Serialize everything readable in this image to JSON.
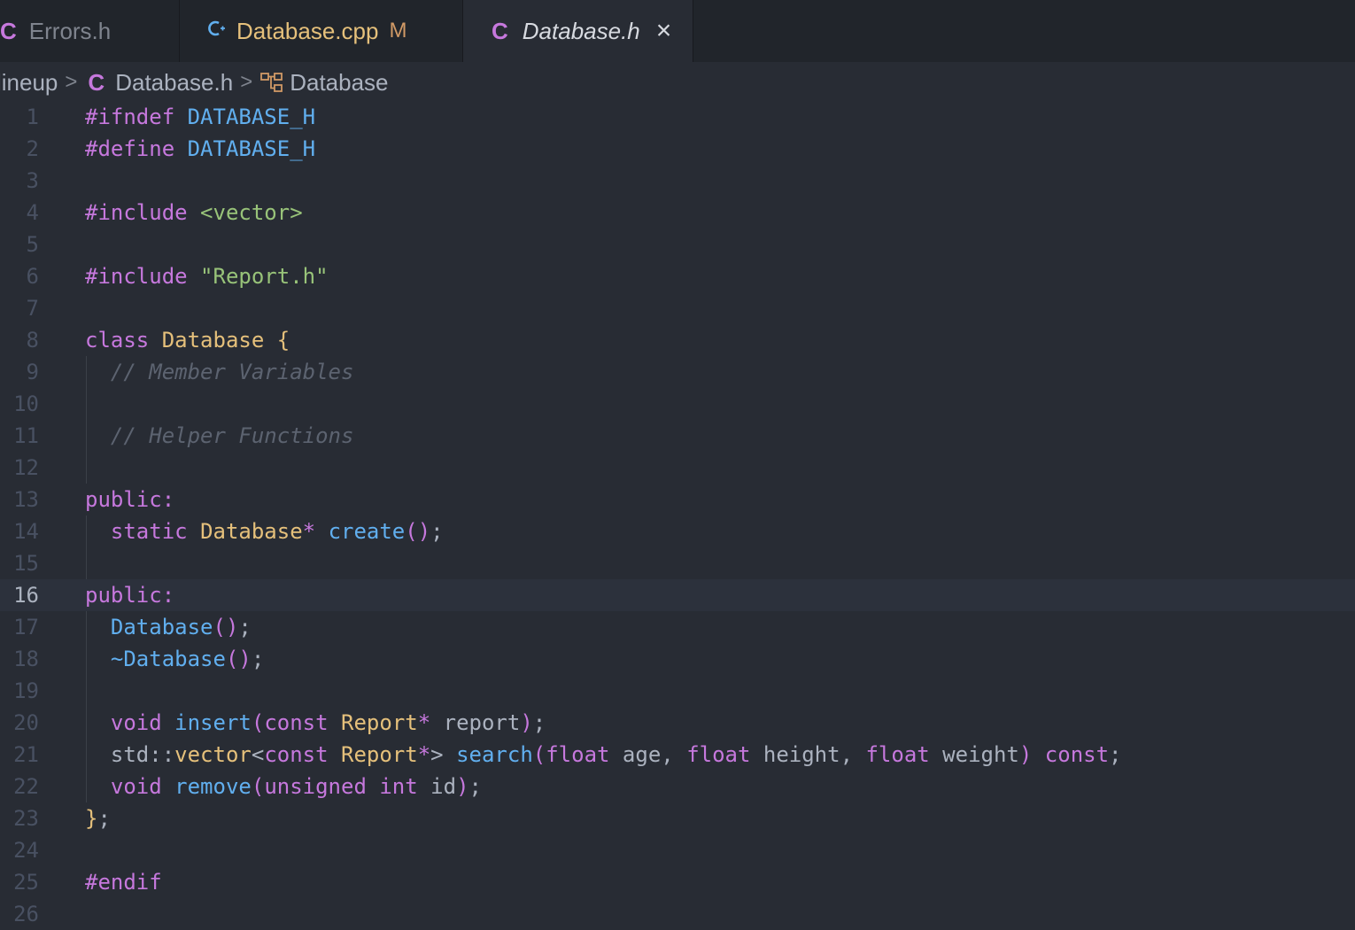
{
  "tabs": [
    {
      "icon": "C",
      "label": "Errors.h",
      "modified": "",
      "active": false
    },
    {
      "icon": "C+",
      "label": "Database.cpp",
      "modified": "M",
      "active": false
    },
    {
      "icon": "C",
      "label": "Database.h",
      "modified": "",
      "active": true,
      "close": "×"
    }
  ],
  "breadcrumb": {
    "folder": "lineup",
    "file_icon": "C",
    "file": "Database.h",
    "symbol": "Database"
  },
  "editor": {
    "current_line": 16,
    "lines": [
      {
        "n": "1",
        "tokens": [
          [
            "pp",
            "#ifndef"
          ],
          [
            "plain",
            " "
          ],
          [
            "mac",
            "DATABASE_H"
          ]
        ]
      },
      {
        "n": "2",
        "tokens": [
          [
            "pp",
            "#define"
          ],
          [
            "plain",
            " "
          ],
          [
            "mac",
            "DATABASE_H"
          ]
        ]
      },
      {
        "n": "3",
        "tokens": []
      },
      {
        "n": "4",
        "tokens": [
          [
            "pp",
            "#include"
          ],
          [
            "plain",
            " "
          ],
          [
            "str",
            "<vector>"
          ]
        ]
      },
      {
        "n": "5",
        "tokens": []
      },
      {
        "n": "6",
        "tokens": [
          [
            "pp",
            "#include"
          ],
          [
            "plain",
            " "
          ],
          [
            "str",
            "\"Report.h\""
          ]
        ]
      },
      {
        "n": "7",
        "tokens": []
      },
      {
        "n": "8",
        "tokens": [
          [
            "kw",
            "class"
          ],
          [
            "plain",
            " "
          ],
          [
            "cls",
            "Database"
          ],
          [
            "plain",
            " "
          ],
          [
            "br",
            "{"
          ]
        ]
      },
      {
        "n": "9",
        "tokens": [
          [
            "plain",
            "  "
          ],
          [
            "cm",
            "// Member Variables"
          ]
        ]
      },
      {
        "n": "10",
        "tokens": []
      },
      {
        "n": "11",
        "tokens": [
          [
            "plain",
            "  "
          ],
          [
            "cm",
            "// Helper Functions"
          ]
        ]
      },
      {
        "n": "12",
        "tokens": []
      },
      {
        "n": "13",
        "tokens": [
          [
            "kw",
            "public:"
          ]
        ]
      },
      {
        "n": "14",
        "tokens": [
          [
            "plain",
            "  "
          ],
          [
            "kw",
            "static"
          ],
          [
            "plain",
            " "
          ],
          [
            "cls",
            "Database"
          ],
          [
            "kw",
            "*"
          ],
          [
            "plain",
            " "
          ],
          [
            "fn",
            "create"
          ],
          [
            "pa",
            "()"
          ],
          [
            "op",
            ";"
          ]
        ]
      },
      {
        "n": "15",
        "tokens": []
      },
      {
        "n": "16",
        "tokens": [
          [
            "kw",
            "public:"
          ]
        ]
      },
      {
        "n": "17",
        "tokens": [
          [
            "plain",
            "  "
          ],
          [
            "fn",
            "Database"
          ],
          [
            "pa",
            "()"
          ],
          [
            "op",
            ";"
          ]
        ]
      },
      {
        "n": "18",
        "tokens": [
          [
            "plain",
            "  "
          ],
          [
            "fn",
            "~Database"
          ],
          [
            "pa",
            "()"
          ],
          [
            "op",
            ";"
          ]
        ]
      },
      {
        "n": "19",
        "tokens": []
      },
      {
        "n": "20",
        "tokens": [
          [
            "plain",
            "  "
          ],
          [
            "kw",
            "void"
          ],
          [
            "plain",
            " "
          ],
          [
            "fn",
            "insert"
          ],
          [
            "pa",
            "("
          ],
          [
            "kw",
            "const"
          ],
          [
            "plain",
            " "
          ],
          [
            "cls",
            "Report"
          ],
          [
            "kw",
            "*"
          ],
          [
            "plain",
            " report"
          ],
          [
            "pa",
            ")"
          ],
          [
            "op",
            ";"
          ]
        ]
      },
      {
        "n": "21",
        "tokens": [
          [
            "plain",
            "  std::"
          ],
          [
            "cls",
            "vector"
          ],
          [
            "op",
            "<"
          ],
          [
            "kw",
            "const"
          ],
          [
            "plain",
            " "
          ],
          [
            "cls",
            "Report"
          ],
          [
            "kw",
            "*"
          ],
          [
            "op",
            ">"
          ],
          [
            "plain",
            " "
          ],
          [
            "fn",
            "search"
          ],
          [
            "pa",
            "("
          ],
          [
            "kw",
            "float"
          ],
          [
            "plain",
            " age, "
          ],
          [
            "kw",
            "float"
          ],
          [
            "plain",
            " height, "
          ],
          [
            "kw",
            "float"
          ],
          [
            "plain",
            " weight"
          ],
          [
            "pa",
            ")"
          ],
          [
            "plain",
            " "
          ],
          [
            "kw",
            "const"
          ],
          [
            "op",
            ";"
          ]
        ]
      },
      {
        "n": "22",
        "tokens": [
          [
            "plain",
            "  "
          ],
          [
            "kw",
            "void"
          ],
          [
            "plain",
            " "
          ],
          [
            "fn",
            "remove"
          ],
          [
            "pa",
            "("
          ],
          [
            "kw",
            "unsigned"
          ],
          [
            "plain",
            " "
          ],
          [
            "kw",
            "int"
          ],
          [
            "plain",
            " id"
          ],
          [
            "pa",
            ")"
          ],
          [
            "op",
            ";"
          ]
        ]
      },
      {
        "n": "23",
        "tokens": [
          [
            "br",
            "}"
          ],
          [
            "op",
            ";"
          ]
        ]
      },
      {
        "n": "24",
        "tokens": []
      },
      {
        "n": "25",
        "tokens": [
          [
            "pp",
            "#endif"
          ]
        ]
      },
      {
        "n": "26",
        "tokens": []
      }
    ]
  }
}
